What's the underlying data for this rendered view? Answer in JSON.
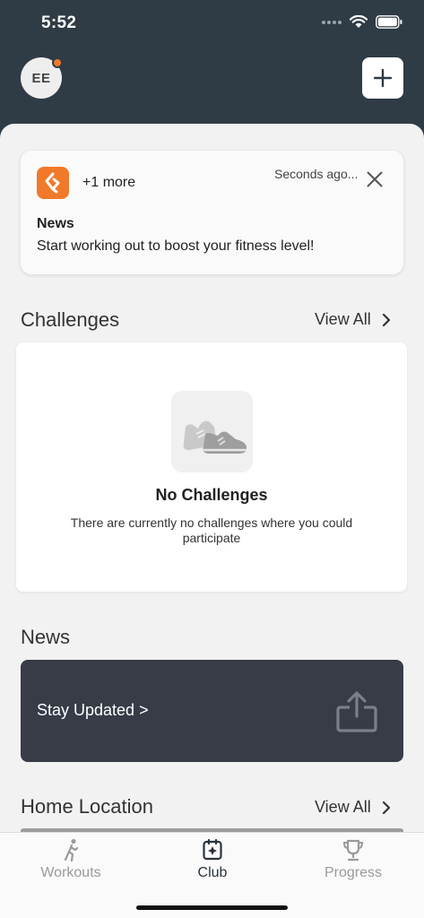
{
  "status_bar": {
    "time": "5:52"
  },
  "header": {
    "avatar_initials": "EE",
    "add_icon": "plus-icon"
  },
  "notification": {
    "logo_icon": "app-logo-icon",
    "more": "+1 more",
    "time": "Seconds ago...",
    "title": "News",
    "body": "Start working out to boost your fitness level!"
  },
  "challenges": {
    "title": "Challenges",
    "view_all": "View All",
    "empty_title": "No Challenges",
    "empty_desc": "There are currently no challenges where you could participate"
  },
  "news": {
    "title": "News",
    "card_label": "Stay Updated >",
    "icon": "share-icon"
  },
  "home_location": {
    "title": "Home Location",
    "view_all": "View All"
  },
  "tabs": [
    {
      "label": "Workouts",
      "icon": "workout-figure-icon",
      "active": false
    },
    {
      "label": "Club",
      "icon": "club-icon",
      "active": true
    },
    {
      "label": "Progress",
      "icon": "trophy-icon",
      "active": false
    }
  ],
  "colors": {
    "header_bg": "#2f3b45",
    "accent": "#f07a2a",
    "news_card": "#373c47",
    "content_bg": "#f2f2f2"
  }
}
